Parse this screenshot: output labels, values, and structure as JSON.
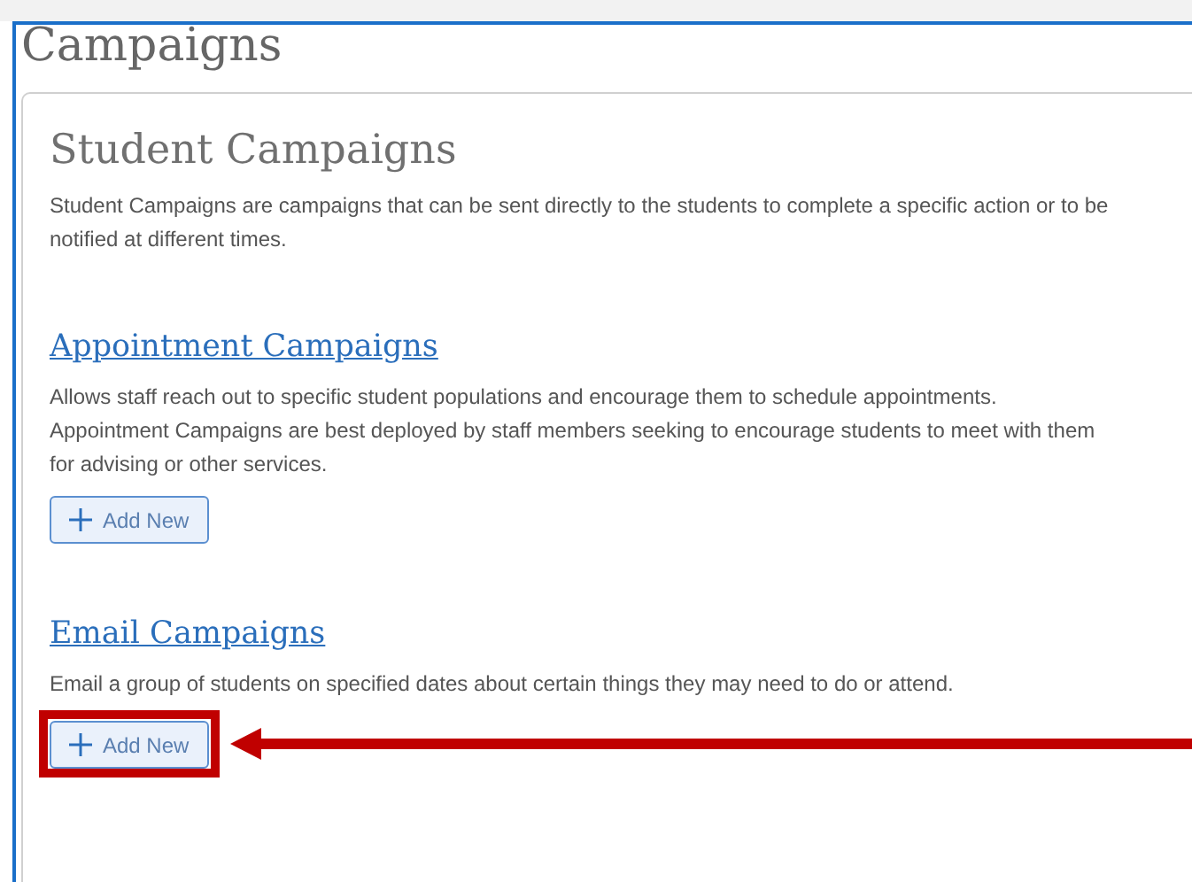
{
  "page_title": "Campaigns",
  "card": {
    "heading": "Student Campaigns",
    "description": "Student Campaigns are campaigns that can be sent directly to the students to complete a specific action or to be notified at different times.",
    "sections": [
      {
        "heading": "Appointment Campaigns",
        "description": "Allows staff reach out to specific student populations and encourage them to schedule appointments. Appointment Campaigns are best deployed by staff members seeking to encourage students to meet with them for advising or other services.",
        "button": "Add New",
        "highlighted": false
      },
      {
        "heading": "Email Campaigns",
        "description": "Email a group of students on specified dates about certain things they may need to do or attend.",
        "button": "Add New",
        "highlighted": true
      }
    ]
  }
}
